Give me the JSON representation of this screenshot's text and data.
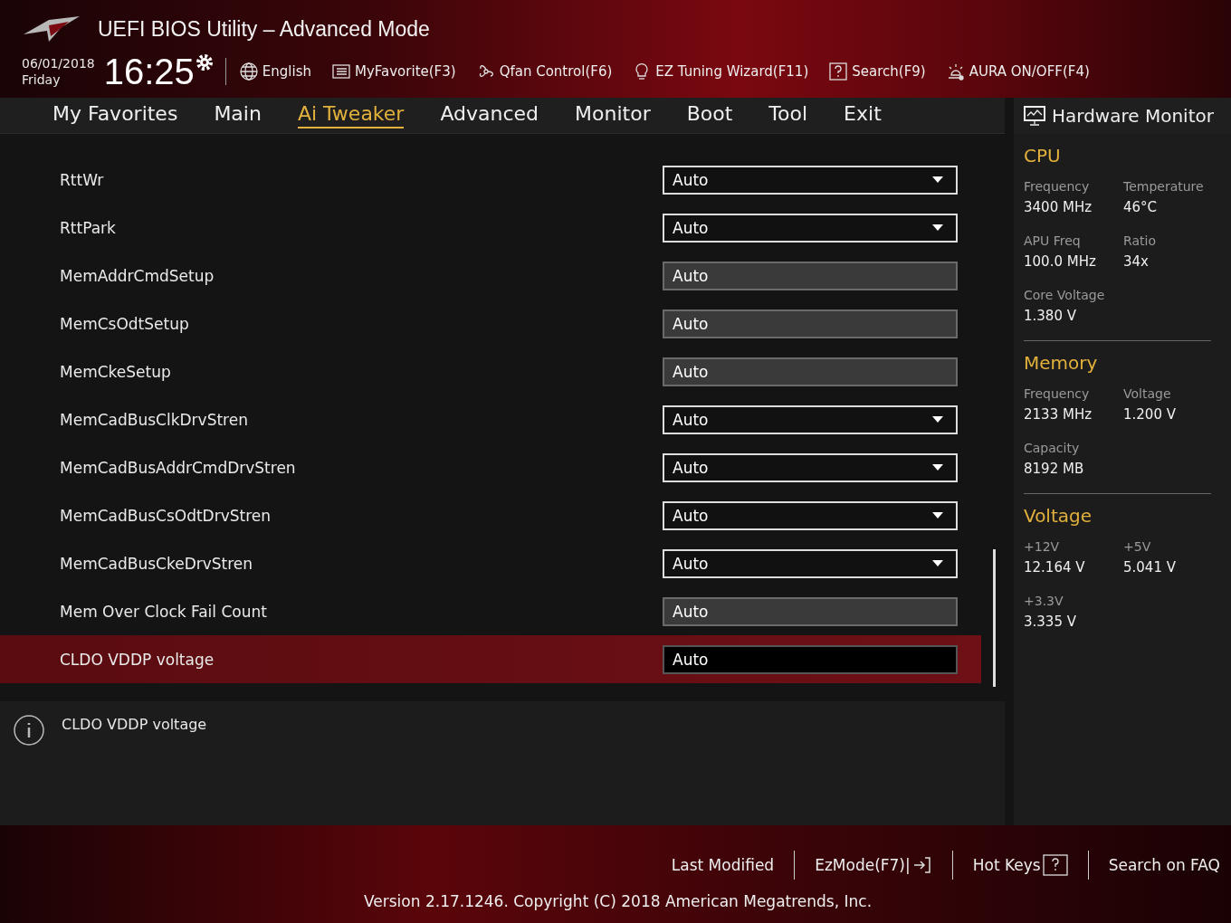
{
  "window": {
    "title": "UEFI BIOS Utility – Advanced Mode"
  },
  "clock": {
    "date": "06/01/2018",
    "day": "Friday",
    "time": "16:25"
  },
  "toolbar": [
    {
      "kind": "globe",
      "label": "English"
    },
    {
      "kind": "list",
      "label": "MyFavorite(F3)"
    },
    {
      "kind": "fan",
      "label": "Qfan Control(F6)"
    },
    {
      "kind": "bulb",
      "label": "EZ Tuning Wizard(F11)"
    },
    {
      "kind": "help",
      "label": "Search(F9)"
    },
    {
      "kind": "aura",
      "label": "AURA ON/OFF(F4)"
    }
  ],
  "tabs": [
    {
      "label": "My Favorites",
      "selected": false
    },
    {
      "label": "Main",
      "selected": false
    },
    {
      "label": "Ai Tweaker",
      "selected": true
    },
    {
      "label": "Advanced",
      "selected": false
    },
    {
      "label": "Monitor",
      "selected": false
    },
    {
      "label": "Boot",
      "selected": false
    },
    {
      "label": "Tool",
      "selected": false
    },
    {
      "label": "Exit",
      "selected": false
    }
  ],
  "settings": [
    {
      "label": "RttWr",
      "value": "Auto",
      "kind": "dropdown",
      "selected": false
    },
    {
      "label": "RttPark",
      "value": "Auto",
      "kind": "dropdown",
      "selected": false
    },
    {
      "label": "MemAddrCmdSetup",
      "value": "Auto",
      "kind": "field",
      "selected": false
    },
    {
      "label": "MemCsOdtSetup",
      "value": "Auto",
      "kind": "field",
      "selected": false
    },
    {
      "label": "MemCkeSetup",
      "value": "Auto",
      "kind": "field",
      "selected": false
    },
    {
      "label": "MemCadBusClkDrvStren",
      "value": "Auto",
      "kind": "dropdown",
      "selected": false
    },
    {
      "label": "MemCadBusAddrCmdDrvStren",
      "value": "Auto",
      "kind": "dropdown",
      "selected": false
    },
    {
      "label": "MemCadBusCsOdtDrvStren",
      "value": "Auto",
      "kind": "dropdown",
      "selected": false
    },
    {
      "label": "MemCadBusCkeDrvStren",
      "value": "Auto",
      "kind": "dropdown",
      "selected": false
    },
    {
      "label": "Mem Over Clock Fail Count",
      "value": "Auto",
      "kind": "field",
      "selected": false
    },
    {
      "label": "CLDO VDDP voltage",
      "value": "Auto",
      "kind": "field",
      "selected": true
    }
  ],
  "help": {
    "text": "CLDO VDDP voltage"
  },
  "hardware_monitor": {
    "title": "Hardware Monitor",
    "sections": [
      {
        "title": "CPU",
        "stats": [
          {
            "label": "Frequency",
            "value": "3400 MHz"
          },
          {
            "label": "Temperature",
            "value": "46°C"
          },
          {
            "label": "APU Freq",
            "value": "100.0 MHz"
          },
          {
            "label": "Ratio",
            "value": "34x"
          },
          {
            "label": "Core Voltage",
            "value": "1.380 V"
          }
        ]
      },
      {
        "title": "Memory",
        "stats": [
          {
            "label": "Frequency",
            "value": "2133 MHz"
          },
          {
            "label": "Voltage",
            "value": "1.200 V"
          },
          {
            "label": "Capacity",
            "value": "8192 MB"
          }
        ]
      },
      {
        "title": "Voltage",
        "stats": [
          {
            "label": "+12V",
            "value": "12.164 V"
          },
          {
            "label": "+5V",
            "value": "5.041 V"
          },
          {
            "label": "+3.3V",
            "value": "3.335 V"
          }
        ]
      }
    ]
  },
  "footer": {
    "links": [
      {
        "kind": "text",
        "label": "Last Modified"
      },
      {
        "kind": "ezmode",
        "label": "EzMode(F7)|"
      },
      {
        "kind": "hotkeys",
        "label": "Hot Keys"
      },
      {
        "kind": "text",
        "label": "Search on FAQ"
      }
    ],
    "version": "Version 2.17.1246. Copyright (C) 2018 American Megatrends, Inc."
  }
}
